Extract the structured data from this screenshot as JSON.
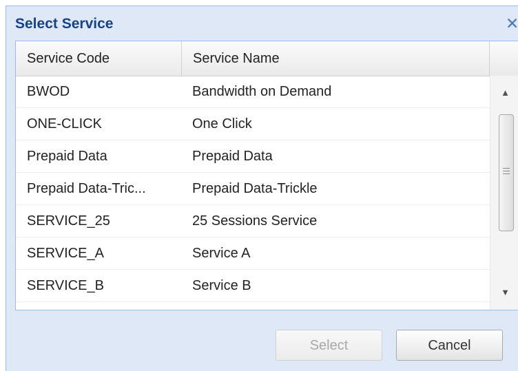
{
  "dialog": {
    "title": "Select Service",
    "close_icon": "close-x-icon"
  },
  "grid": {
    "columns": [
      "Service Code",
      "Service Name"
    ],
    "rows": [
      {
        "code": "BWOD",
        "name": "Bandwidth on Demand"
      },
      {
        "code": "ONE-CLICK",
        "name": "One Click"
      },
      {
        "code": "Prepaid Data",
        "name": "Prepaid Data"
      },
      {
        "code": "Prepaid Data-Tric...",
        "name": "Prepaid Data-Trickle"
      },
      {
        "code": "SERVICE_25",
        "name": "25 Sessions Service"
      },
      {
        "code": "SERVICE_A",
        "name": "Service A"
      },
      {
        "code": "SERVICE_B",
        "name": "Service B"
      }
    ],
    "scrollbar": {
      "up_icon": "scroll-up-arrow-icon",
      "down_icon": "scroll-down-arrow-icon"
    }
  },
  "footer": {
    "select_label": "Select",
    "select_enabled": false,
    "cancel_label": "Cancel"
  },
  "colors": {
    "title": "#15428b",
    "dialog_bg": "#dfe8f6",
    "border": "#99bbe8"
  }
}
